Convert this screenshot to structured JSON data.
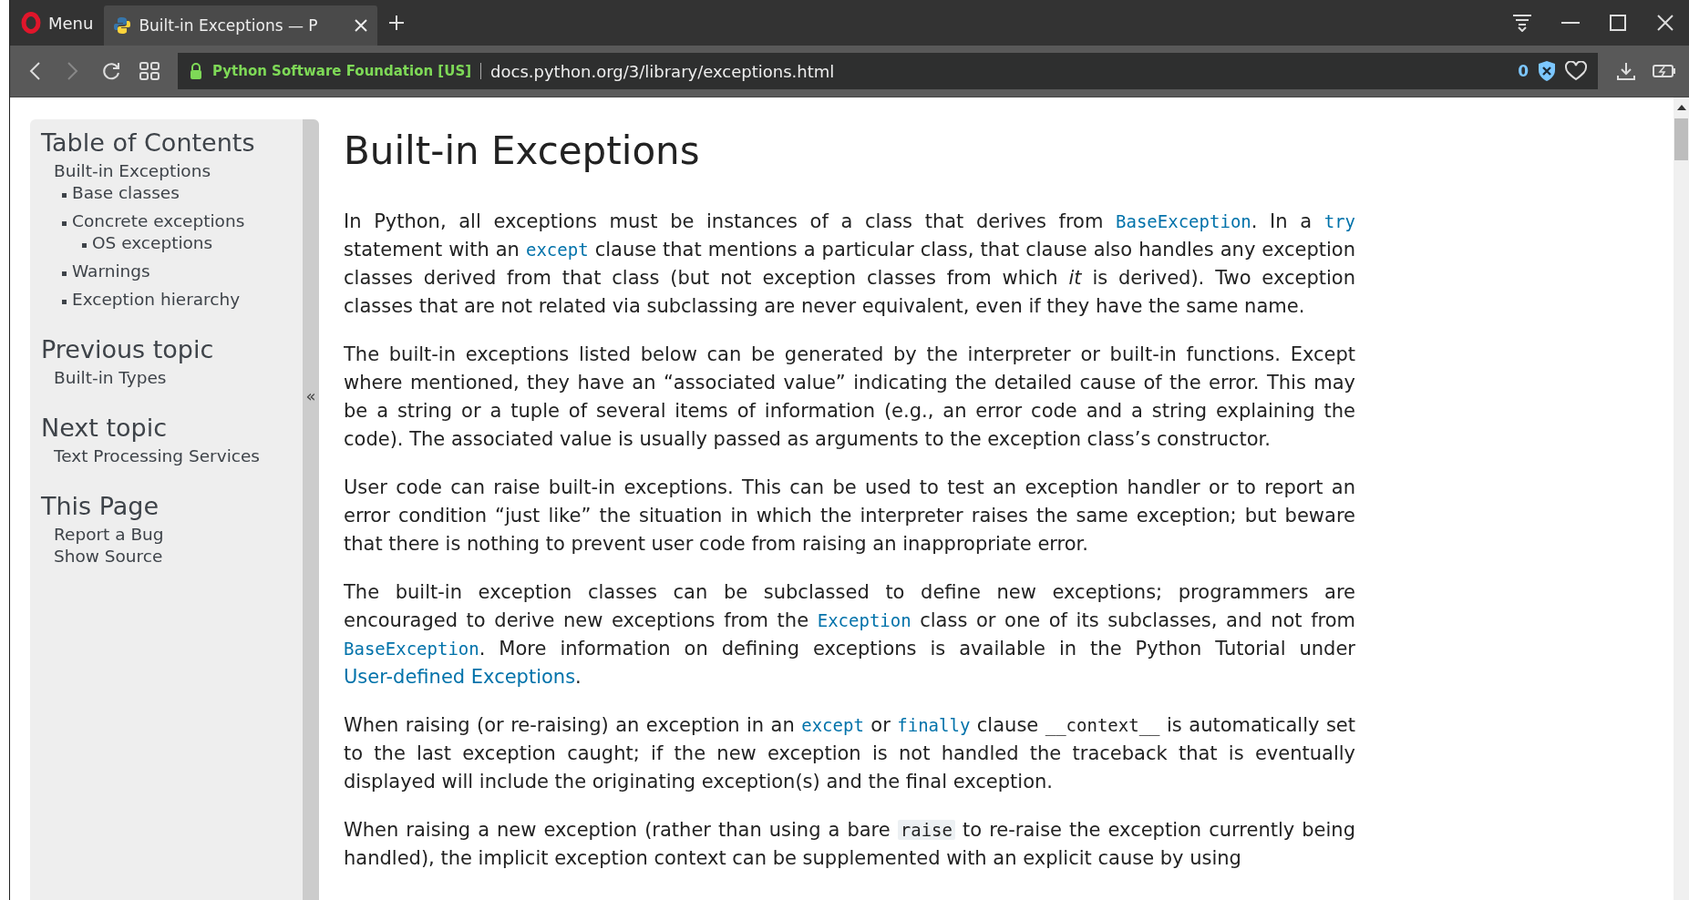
{
  "browser": {
    "menu_label": "Menu",
    "tabs": [
      {
        "title": "Built-in Exceptions — P",
        "selected": true
      }
    ],
    "address": {
      "site_identity": "Python Software Foundation [US]",
      "url": "docs.python.org/3/library/exceptions.html"
    },
    "blocked_count": "0"
  },
  "sidebar": {
    "sections": [
      {
        "heading": "Table of Contents",
        "items": [
          {
            "label": "Built-in Exceptions",
            "children": [
              {
                "label": "Base classes"
              },
              {
                "label": "Concrete exceptions",
                "children": [
                  {
                    "label": "OS exceptions"
                  }
                ]
              },
              {
                "label": "Warnings"
              },
              {
                "label": "Exception hierarchy"
              }
            ]
          }
        ]
      },
      {
        "heading": "Previous topic",
        "items": [
          {
            "label": "Built-in Types"
          }
        ]
      },
      {
        "heading": "Next topic",
        "items": [
          {
            "label": "Text Processing Services"
          }
        ]
      },
      {
        "heading": "This Page",
        "items": [
          {
            "label": "Report a Bug"
          },
          {
            "label": "Show Source"
          }
        ]
      }
    ],
    "collapse_label": "«"
  },
  "main": {
    "title": "Built-in Exceptions",
    "paragraphs": [
      [
        {
          "kind": "text",
          "text": "In Python, all exceptions must be instances of a class that derives from "
        },
        {
          "kind": "code_link",
          "text": "BaseException"
        },
        {
          "kind": "text",
          "text": ". In a "
        },
        {
          "kind": "code_link",
          "text": "try"
        },
        {
          "kind": "text",
          "text": " statement with an "
        },
        {
          "kind": "code_link",
          "text": "except"
        },
        {
          "kind": "text",
          "text": " clause that mentions a particular class, that clause also handles any exception classes derived from that class (but not exception classes from which *it* is derived). Two exception classes that are not related via subclassing are never equivalent, even if they have the same name."
        }
      ],
      [
        {
          "kind": "text",
          "text": "The built-in exceptions listed below can be generated by the interpreter or built-in functions. Except where mentioned, they have an “associated value” indicating the detailed cause of the error. This may be a string or a tuple of several items of information (e.g., an error code and a string explaining the code). The associated value is usually passed as arguments to the exception class’s constructor."
        }
      ],
      [
        {
          "kind": "text",
          "text": "User code can raise built-in exceptions. This can be used to test an exception handler or to report an error condition “just like” the situation in which the interpreter raises the same exception; but beware that there is nothing to prevent user code from raising an inappropriate error."
        }
      ],
      [
        {
          "kind": "text",
          "text": "The built-in exception classes can be subclassed to define new exceptions; programmers are encouraged to derive new exceptions from the "
        },
        {
          "kind": "code_link",
          "text": "Exception"
        },
        {
          "kind": "text",
          "text": " class or one of its subclasses, and not from "
        },
        {
          "kind": "code_link",
          "text": "BaseException"
        },
        {
          "kind": "text",
          "text": ". More information on defining exceptions is available in the Python Tutorial under "
        },
        {
          "kind": "link",
          "text": "User-defined Exceptions"
        },
        {
          "kind": "text",
          "text": "."
        }
      ],
      [
        {
          "kind": "text",
          "text": "When raising (or re-raising) an exception in an "
        },
        {
          "kind": "code_link",
          "text": "except"
        },
        {
          "kind": "text",
          "text": " or "
        },
        {
          "kind": "code_link",
          "text": "finally"
        },
        {
          "kind": "text",
          "text": " clause "
        },
        {
          "kind": "code",
          "text": "__context__"
        },
        {
          "kind": "text",
          "text": " is automatically set to the last exception caught; if the new exception is not handled the traceback that is eventually displayed will include the originating exception(s) and the final exception."
        }
      ],
      [
        {
          "kind": "text",
          "text": "When raising a new exception (rather than using a bare "
        },
        {
          "kind": "literal",
          "text": "raise"
        },
        {
          "kind": "text",
          "text": " to re-raise the exception currently being handled), the implicit exception context can be supplemented with an explicit cause by using"
        }
      ]
    ]
  }
}
